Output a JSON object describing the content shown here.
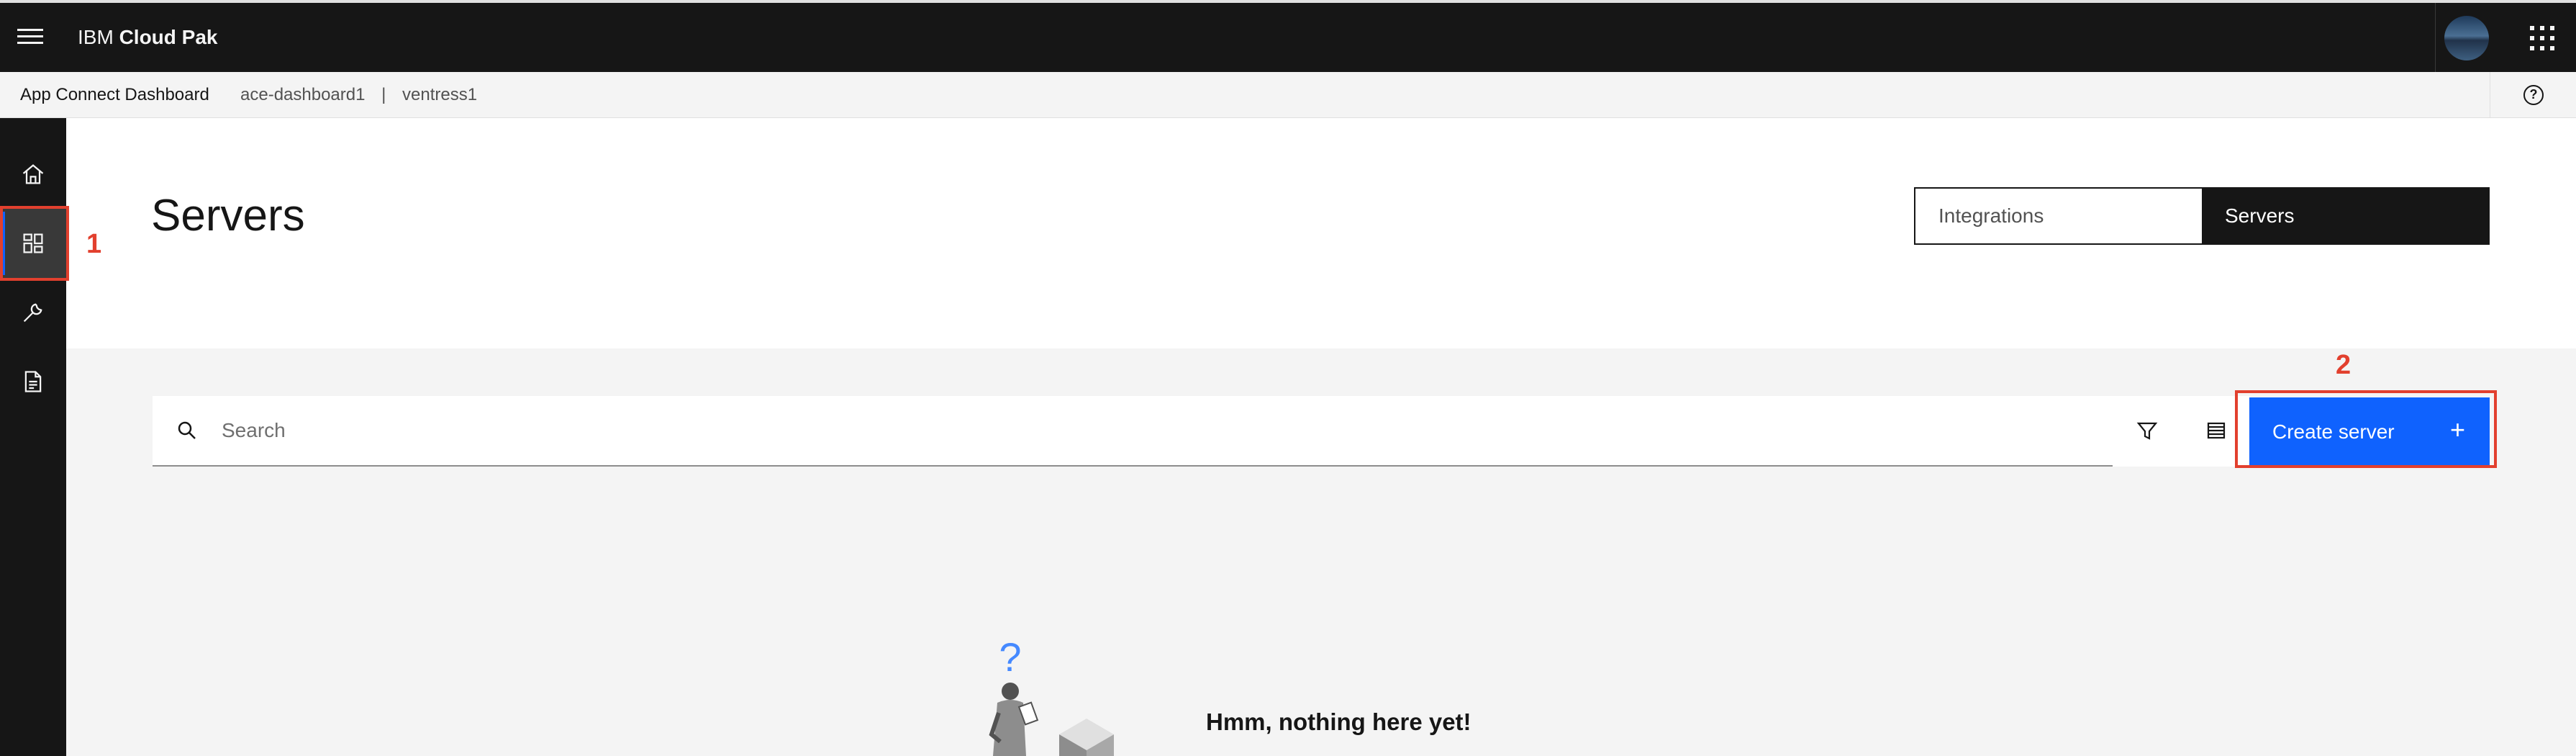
{
  "header": {
    "brand_prefix": "IBM",
    "brand_name": "Cloud Pak",
    "icons": [
      "menu-icon",
      "user-avatar",
      "app-switcher-icon"
    ]
  },
  "breadcrumb": {
    "app": "App Connect Dashboard",
    "instance": "ace-dashboard1",
    "separator": "|",
    "namespace": "ventress1",
    "help_icon": "help-icon",
    "help_glyph": "?"
  },
  "sidenav": {
    "items": [
      {
        "name": "home",
        "icon": "home-icon"
      },
      {
        "name": "dashboard",
        "icon": "dashboard-icon",
        "active": true
      },
      {
        "name": "tools",
        "icon": "wrench-icon"
      },
      {
        "name": "documents",
        "icon": "document-icon"
      }
    ]
  },
  "page": {
    "title": "Servers",
    "view_switch": [
      {
        "label": "Integrations",
        "selected": false
      },
      {
        "label": "Servers",
        "selected": true
      }
    ]
  },
  "toolbar": {
    "search_placeholder": "Search",
    "search_value": "",
    "filter_icon": "filter-icon",
    "view_icon": "table-view-icon",
    "create_label": "Create server",
    "create_icon": "+"
  },
  "annotations": {
    "marker_1": "1",
    "marker_2": "2",
    "color": "#e2402e"
  },
  "empty_state": {
    "title": "Hmm, nothing here yet!",
    "body": "",
    "illustration_glyph": "?"
  },
  "colors": {
    "header_bg": "#161616",
    "accent": "#0f62fe",
    "content_bg": "#f4f4f4"
  }
}
